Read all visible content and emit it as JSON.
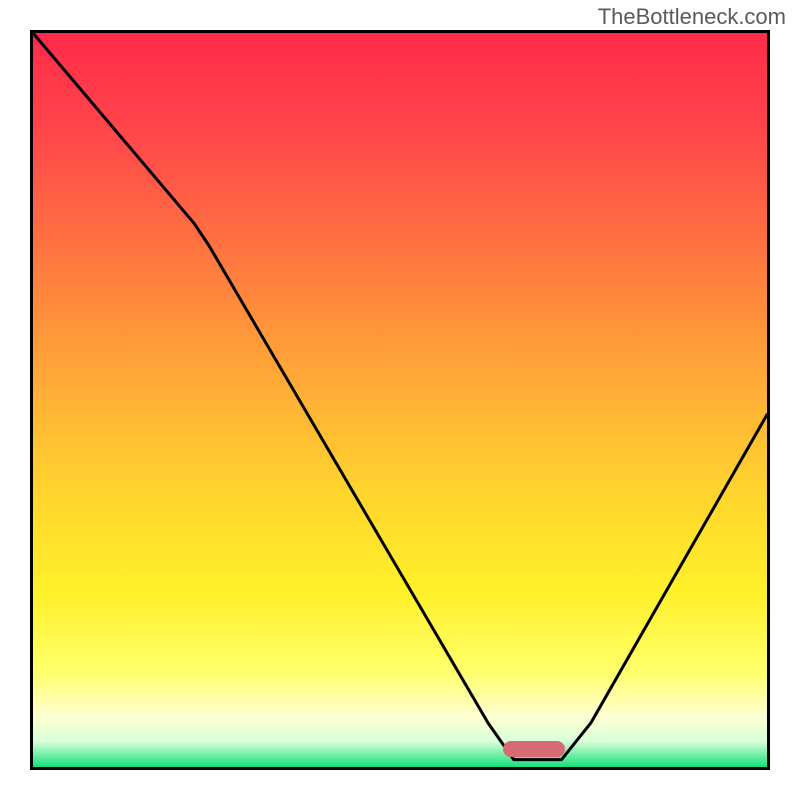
{
  "watermark": "TheBottleneck.com",
  "chart_data": {
    "type": "line",
    "title": "",
    "xlabel": "",
    "ylabel": "",
    "xlim": [
      0,
      100
    ],
    "ylim": [
      0,
      100
    ],
    "grid": false,
    "legend": false,
    "background_gradient": {
      "stops": [
        {
          "offset": 0.0,
          "color": "#ff2a4a"
        },
        {
          "offset": 0.15,
          "color": "#ff4a49"
        },
        {
          "offset": 0.3,
          "color": "#ff7540"
        },
        {
          "offset": 0.45,
          "color": "#ffa338"
        },
        {
          "offset": 0.62,
          "color": "#ffd32e"
        },
        {
          "offset": 0.76,
          "color": "#fff029"
        },
        {
          "offset": 0.87,
          "color": "#ffff6a"
        },
        {
          "offset": 0.93,
          "color": "#ffffd0"
        },
        {
          "offset": 0.965,
          "color": "#d9ffd9"
        },
        {
          "offset": 1.0,
          "color": "#15e07a"
        }
      ]
    },
    "curve": {
      "color": "#000000",
      "width": 3,
      "points": [
        {
          "x": 0.0,
          "y": 100.0
        },
        {
          "x": 22.0,
          "y": 74.0
        },
        {
          "x": 24.0,
          "y": 71.0
        },
        {
          "x": 62.0,
          "y": 6.0
        },
        {
          "x": 65.5,
          "y": 1.0
        },
        {
          "x": 72.0,
          "y": 1.0
        },
        {
          "x": 76.0,
          "y": 6.0
        },
        {
          "x": 100.0,
          "y": 48.0
        }
      ]
    },
    "optimum_marker": {
      "x_start": 64.0,
      "x_end": 72.5,
      "y": 1.3,
      "height": 2.2,
      "color": "#d86a74"
    }
  }
}
